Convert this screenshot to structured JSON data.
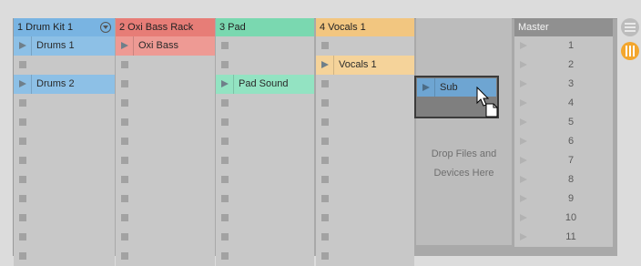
{
  "colors": {
    "drum": "#79b4e2",
    "bass": "#e77d77",
    "pad": "#7ad8b0",
    "vocals": "#f2c680",
    "drum_clip": "#8dc0e6",
    "bass_clip": "#ee9a94",
    "pad_clip": "#93e3c2",
    "vocals_clip": "#f5d39a"
  },
  "tracks": [
    {
      "key": "drum",
      "header": "1 Drum Kit 1",
      "has_menu": true,
      "clips": {
        "0": "Drums 1",
        "2": "Drums 2"
      }
    },
    {
      "key": "bass",
      "header": "2 Oxi Bass Rack",
      "has_menu": false,
      "clips": {
        "0": "Oxi Bass"
      }
    },
    {
      "key": "pad",
      "header": "3 Pad",
      "has_menu": false,
      "clips": {
        "2": "Pad Sound"
      }
    },
    {
      "key": "vocals",
      "header": "4 Vocals 1",
      "has_menu": false,
      "clips": {
        "1": "Vocals 1"
      }
    }
  ],
  "drop_area": {
    "line1": "Drop Files and",
    "line2": "Devices Here"
  },
  "master": {
    "header": "Master",
    "scenes": [
      "1",
      "2",
      "3",
      "4",
      "5",
      "6",
      "7",
      "8",
      "9",
      "10",
      "11"
    ]
  },
  "dragging_clip": {
    "name": "Sub"
  },
  "side_icons": [
    "menu-icon",
    "mixer-icon"
  ]
}
